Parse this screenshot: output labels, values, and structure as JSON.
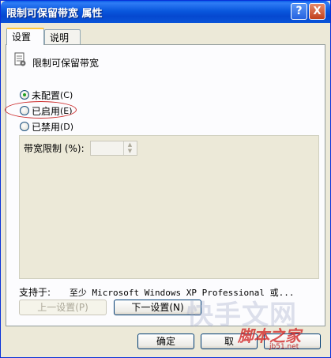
{
  "window": {
    "title": "限制可保留带宽 属性",
    "help_symbol": "?",
    "close_symbol": "X"
  },
  "tabs": [
    {
      "label": "设置",
      "active": true
    },
    {
      "label": "说明",
      "active": false
    }
  ],
  "policy": {
    "icon": "policy-document-icon",
    "title": "限制可保留带宽"
  },
  "options": [
    {
      "label": "未配置",
      "hotkey": "(C)",
      "checked": true
    },
    {
      "label": "已启用",
      "hotkey": "(E)",
      "checked": false
    },
    {
      "label": "已禁用",
      "hotkey": "(D)",
      "checked": false
    }
  ],
  "bandwidth": {
    "label": "带宽限制 (%):",
    "value": ""
  },
  "supported": {
    "label": "支持于:",
    "value": "至少 Microsoft Windows XP Professional 或..."
  },
  "buttons": {
    "prev": "上一设置(P)",
    "next": "下一设置(N)",
    "ok": "确定",
    "cancel": "取",
    "apply": ""
  },
  "overlay": {
    "watermark": "快手文网",
    "stamp": "脚本之家",
    "url": "jb51.net"
  },
  "colors": {
    "highlight": "#cc2a2a",
    "titlebar": "#0a58de"
  }
}
